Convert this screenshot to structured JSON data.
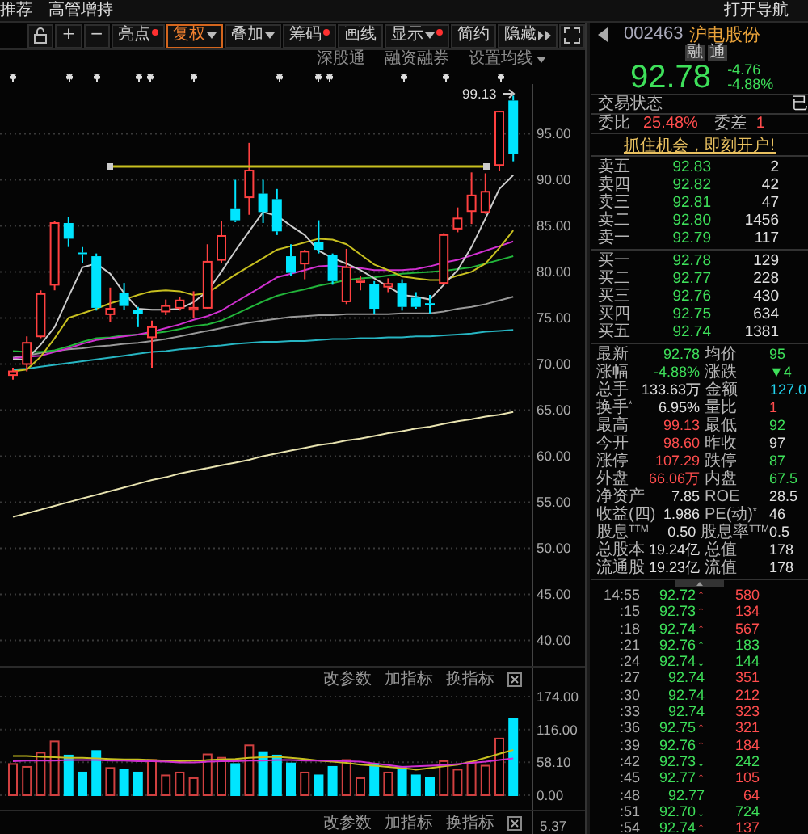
{
  "top_bar": {
    "tabs": [
      "推荐",
      "高管增持"
    ],
    "nav_button": "打开导航"
  },
  "toolbar": [
    {
      "kind": "lock"
    },
    {
      "kind": "text",
      "label": "+",
      "selected": false,
      "dot": false,
      "dropdown": false
    },
    {
      "kind": "text",
      "label": "−",
      "selected": false,
      "dot": false,
      "dropdown": false
    },
    {
      "kind": "text",
      "label": "亮点",
      "selected": false,
      "dot": true,
      "dropdown": false
    },
    {
      "kind": "text",
      "label": "复权",
      "selected": true,
      "dot": false,
      "dropdown": true
    },
    {
      "kind": "text",
      "label": "叠加",
      "selected": false,
      "dot": false,
      "dropdown": true
    },
    {
      "kind": "text",
      "label": "筹码",
      "selected": false,
      "dot": true,
      "dropdown": false
    },
    {
      "kind": "text",
      "label": "画线",
      "selected": false,
      "dot": false,
      "dropdown": false
    },
    {
      "kind": "text",
      "label": "显示",
      "selected": false,
      "dot": true,
      "dropdown": true
    },
    {
      "kind": "text",
      "label": "简约",
      "selected": false,
      "dot": false,
      "dropdown": false
    },
    {
      "kind": "more",
      "label": "隐藏"
    },
    {
      "kind": "fullscreen"
    }
  ],
  "sub_toolbar": {
    "links": [
      "深股通",
      "融资融券"
    ],
    "ma_settings": "设置均线"
  },
  "chart": {
    "high_label": "99.13",
    "chart_data": {
      "type": "candlestick",
      "grid": true,
      "ylim": [
        37.23,
        100.39
      ],
      "yticks": [
        {
          "value": 95,
          "label": "95.00"
        },
        {
          "value": 90,
          "label": "90.00"
        },
        {
          "value": 85,
          "label": "85.00"
        },
        {
          "value": 80,
          "label": "80.00"
        },
        {
          "value": 75,
          "label": "75.00"
        },
        {
          "value": 70,
          "label": "70.00"
        },
        {
          "value": 65,
          "label": "65.00"
        },
        {
          "value": 60,
          "label": "60.00"
        },
        {
          "value": 55,
          "label": "55.00"
        },
        {
          "value": 50,
          "label": "50.00"
        },
        {
          "value": 45,
          "label": "45.00"
        },
        {
          "value": 40,
          "label": "40.00"
        }
      ],
      "series": [
        {
          "type": "line",
          "color": "#e8e3b0",
          "values": [
            53.4,
            53.8,
            54.2,
            54.6,
            55.0,
            55.4,
            55.8,
            56.2,
            56.6,
            57.0,
            57.4,
            57.7,
            58.1,
            58.4,
            58.7,
            59.0,
            59.3,
            59.6,
            60.0,
            60.3,
            60.6,
            60.9,
            61.2,
            61.4,
            61.7,
            61.9,
            62.2,
            62.5,
            62.7,
            63.0,
            63.2,
            63.5,
            63.8,
            64.0,
            64.3,
            64.5,
            64.8
          ]
        },
        {
          "type": "line",
          "color": "#27b5c2",
          "values": [
            69.4,
            69.5,
            69.7,
            69.9,
            70.1,
            70.3,
            70.5,
            70.7,
            70.9,
            71.1,
            71.3,
            71.4,
            71.6,
            71.7,
            71.9,
            72.0,
            72.2,
            72.3,
            72.4,
            72.4,
            72.5,
            72.5,
            72.6,
            72.7,
            72.7,
            72.8,
            72.8,
            72.9,
            72.9,
            73.0,
            73.0,
            73.1,
            73.2,
            73.3,
            73.5,
            73.6,
            73.7
          ]
        },
        {
          "type": "line",
          "color": "#999999",
          "values": [
            70.7,
            70.9,
            71.2,
            71.4,
            71.6,
            71.7,
            71.9,
            72.0,
            72.2,
            72.3,
            72.5,
            72.7,
            73.0,
            73.3,
            73.6,
            73.9,
            74.2,
            74.5,
            74.7,
            74.9,
            75.1,
            75.2,
            75.3,
            75.3,
            75.4,
            75.4,
            75.4,
            75.4,
            75.5,
            75.5,
            75.5,
            75.7,
            76.0,
            76.2,
            76.5,
            76.9,
            77.3
          ]
        },
        {
          "type": "line",
          "color": "#22b53a",
          "values": [
            71.4,
            71.3,
            71.3,
            71.5,
            71.9,
            72.4,
            72.8,
            72.9,
            73.1,
            73.2,
            73.3,
            73.5,
            73.8,
            74.1,
            74.3,
            74.7,
            75.4,
            76.1,
            76.8,
            77.4,
            77.8,
            78.1,
            78.5,
            78.8,
            79.1,
            79.3,
            79.4,
            79.6,
            79.8,
            79.9,
            80.0,
            80.1,
            80.3,
            80.5,
            80.9,
            81.3,
            81.7
          ]
        },
        {
          "type": "line",
          "color": "#d030d0",
          "values": [
            70.6,
            70.8,
            70.9,
            71.3,
            71.7,
            72.2,
            72.6,
            72.8,
            73.0,
            73.2,
            73.5,
            73.9,
            74.3,
            74.8,
            75.2,
            75.8,
            76.7,
            77.6,
            78.5,
            79.4,
            79.8,
            80.2,
            80.6,
            80.7,
            80.5,
            80.4,
            80.2,
            80.2,
            80.2,
            80.3,
            80.6,
            81.0,
            81.3,
            81.8,
            82.3,
            82.8,
            83.3
          ]
        },
        {
          "type": "line",
          "color": "#c8c020",
          "values": [
            69.2,
            69.4,
            70.8,
            72.8,
            75.0,
            75.5,
            76.0,
            76.6,
            77.0,
            77.5,
            77.9,
            78.0,
            77.9,
            77.5,
            77.7,
            78.7,
            79.7,
            80.6,
            81.5,
            82.4,
            82.8,
            83.2,
            83.6,
            83.5,
            83.0,
            81.9,
            80.8,
            80.2,
            79.5,
            79.3,
            79.1,
            79.1,
            79.6,
            80.0,
            80.9,
            82.6,
            84.5
          ]
        },
        {
          "type": "line",
          "color": "#cccccc",
          "values": [
            70.5,
            70.5,
            72.1,
            74.0,
            77.3,
            80.5,
            80.9,
            79.8,
            77.7,
            76.0,
            75.9,
            75.9,
            76.0,
            76.7,
            77.9,
            80.0,
            82.3,
            84.4,
            86.5,
            86.1,
            85.0,
            84.0,
            82.3,
            81.5,
            80.9,
            80.2,
            79.3,
            78.4,
            77.5,
            77.3,
            77.0,
            78.6,
            80.2,
            82.7,
            85.8,
            89.0,
            90.5
          ]
        }
      ],
      "ohlc": [
        [
          68.8,
          69.6,
          68.3,
          69.2
        ],
        [
          70,
          73,
          69.2,
          72.3
        ],
        [
          73,
          78,
          72.8,
          77.6
        ],
        [
          78.6,
          85.5,
          78,
          85.3
        ],
        [
          85.3,
          86,
          82.7,
          83.6
        ],
        [
          82.1,
          82.7,
          81,
          82
        ],
        [
          81.7,
          82,
          75.8,
          76.1
        ],
        [
          75.4,
          78.3,
          74.6,
          76
        ],
        [
          77.7,
          78.8,
          75.9,
          76.3
        ],
        [
          75.9,
          76.2,
          74,
          75.4
        ],
        [
          72.9,
          74.7,
          69.6,
          74
        ],
        [
          75.7,
          77,
          75.3,
          76.3
        ],
        [
          76.1,
          77.3,
          75.8,
          76.9
        ],
        [
          75.9,
          77.9,
          75,
          76.1
        ],
        [
          76.1,
          83,
          76,
          81.1
        ],
        [
          81.3,
          85.5,
          81,
          83.9
        ],
        [
          86.9,
          90,
          85.4,
          85.6
        ],
        [
          88.1,
          94,
          86.2,
          91
        ],
        [
          88.5,
          90,
          85.3,
          86.5
        ],
        [
          87.9,
          89,
          84,
          84.4
        ],
        [
          81.7,
          83,
          79.6,
          79.9
        ],
        [
          80.9,
          82.4,
          79.2,
          82.2
        ],
        [
          83.2,
          85.6,
          82,
          82.4
        ],
        [
          81.8,
          82,
          78.6,
          79
        ],
        [
          76.8,
          82.5,
          76.5,
          80.5
        ],
        [
          78.9,
          79.6,
          78,
          79.1
        ],
        [
          78.7,
          79,
          75.4,
          76
        ],
        [
          78.4,
          79.3,
          77.8,
          78.7
        ],
        [
          78.8,
          79.2,
          75.8,
          76.2
        ],
        [
          77.2,
          77.8,
          76,
          76.2
        ],
        [
          76.6,
          77.5,
          75.4,
          76.4
        ],
        [
          78.8,
          84.2,
          78.6,
          84
        ],
        [
          84.7,
          87,
          84.3,
          85.8
        ],
        [
          86.6,
          90.8,
          85.2,
          88.3
        ],
        [
          86.5,
          90.7,
          86.3,
          88.7
        ],
        [
          91.6,
          97.5,
          91,
          97.4
        ],
        [
          98.6,
          99.13,
          92,
          92.8
        ]
      ]
    }
  },
  "volume_panel": {
    "actions": [
      "改参数",
      "加指标",
      "换指标"
    ],
    "chart_data": {
      "type": "bar",
      "grid": true,
      "ylim": [
        0,
        185.4
      ],
      "yticks": [
        {
          "value": 174,
          "label": "174.00"
        },
        {
          "value": 116,
          "label": "116.00"
        },
        {
          "value": 58.1,
          "label": "58.10"
        },
        {
          "value": 0,
          "label": "0.00"
        }
      ],
      "series": [
        {
          "color": "#d04040",
          "values": [
            55,
            50,
            75,
            95,
            null,
            null,
            null,
            48,
            null,
            null,
            62,
            35,
            40,
            30,
            72,
            66,
            null,
            88,
            null,
            null,
            null,
            40,
            null,
            null,
            62,
            30,
            null,
            40,
            null,
            null,
            null,
            60,
            45,
            58,
            52,
            100,
            null
          ]
        },
        {
          "color": "#00e5ff",
          "values": [
            null,
            null,
            null,
            null,
            70,
            40,
            78,
            null,
            45,
            40,
            null,
            null,
            null,
            null,
            null,
            null,
            55,
            null,
            76,
            70,
            56,
            null,
            35,
            50,
            null,
            null,
            55,
            null,
            50,
            35,
            30,
            null,
            null,
            null,
            null,
            null,
            135
          ]
        },
        {
          "type": "line",
          "color": "#c8c020",
          "values": [
            69,
            69,
            68,
            67,
            66,
            66,
            65,
            64,
            63,
            63,
            62,
            61,
            60,
            61,
            62,
            63,
            64,
            66,
            67,
            68,
            66,
            64,
            61,
            59,
            57,
            54,
            52,
            50,
            48,
            45,
            48,
            51,
            54,
            59,
            66,
            73,
            80
          ]
        },
        {
          "type": "line",
          "color": "#d030d0",
          "values": [
            60,
            61,
            61,
            61,
            62,
            62,
            62,
            61,
            61,
            60,
            60,
            59,
            58,
            58,
            59,
            60,
            60,
            61,
            61,
            62,
            62,
            61,
            61,
            61,
            60,
            59,
            56,
            53,
            50,
            51,
            52,
            53,
            55,
            57,
            59,
            62,
            65
          ]
        }
      ]
    }
  },
  "bottom_panel": {
    "actions": [
      "改参数",
      "加指标",
      "换指标"
    ],
    "y_axis": [
      "5.37"
    ]
  },
  "quote": {
    "code": "002463",
    "name": "沪电股份",
    "badges": [
      "融",
      "通"
    ],
    "price": "92.78",
    "change": "-4.76",
    "change_pct": "-4.88%",
    "status": {
      "label": "交易状态",
      "value": "已"
    },
    "ratio": [
      {
        "label": "委比",
        "value": "25.48%"
      },
      {
        "label": "委差",
        "value": "1"
      }
    ],
    "promo": "抓住机会，即刻开户!"
  },
  "order_book": {
    "asks": [
      {
        "label": "卖五",
        "price": "92.83",
        "volume": "2"
      },
      {
        "label": "卖四",
        "price": "92.82",
        "volume": "42"
      },
      {
        "label": "卖三",
        "price": "92.81",
        "volume": "47"
      },
      {
        "label": "卖二",
        "price": "92.80",
        "volume": "1456"
      },
      {
        "label": "卖一",
        "price": "92.79",
        "volume": "117"
      }
    ],
    "bids": [
      {
        "label": "买一",
        "price": "92.78",
        "volume": "129"
      },
      {
        "label": "买二",
        "price": "92.77",
        "volume": "228"
      },
      {
        "label": "买三",
        "price": "92.76",
        "volume": "430"
      },
      {
        "label": "买四",
        "price": "92.75",
        "volume": "634"
      },
      {
        "label": "买五",
        "price": "92.74",
        "volume": "1381"
      }
    ]
  },
  "stats": [
    {
      "cells": [
        {
          "label": "最新",
          "value": "92.78",
          "color": "#3ee05a"
        },
        {
          "label": "均价",
          "value": "95",
          "color": "#3ee05a"
        }
      ]
    },
    {
      "cells": [
        {
          "label": "涨幅",
          "value": "-4.88%",
          "color": "#3ee05a"
        },
        {
          "label": "涨跌",
          "value": "▼4",
          "color": "#3ee05a"
        }
      ]
    },
    {
      "cells": [
        {
          "label": "总手",
          "value": "133.63万",
          "color": "#e0e0e0"
        },
        {
          "label": "金额",
          "value": "127.0",
          "color": "#22d3ee"
        }
      ]
    },
    {
      "cells": [
        {
          "label": "换手$^{*}$",
          "value": "6.95%",
          "color": "#e0e0e0"
        },
        {
          "label": "量比",
          "value": "1",
          "color": "#ff4d4d"
        }
      ]
    },
    {
      "cells": [
        {
          "label": "最高",
          "value": "99.13",
          "color": "#ff4d4d"
        },
        {
          "label": "最低",
          "value": "92",
          "color": "#3ee05a"
        }
      ]
    },
    {
      "cells": [
        {
          "label": "今开",
          "value": "98.60",
          "color": "#ff4d4d"
        },
        {
          "label": "昨收",
          "value": "97",
          "color": "#e0e0e0"
        }
      ]
    },
    {
      "cells": [
        {
          "label": "涨停",
          "value": "107.29",
          "color": "#ff4d4d"
        },
        {
          "label": "跌停",
          "value": "87",
          "color": "#3ee05a"
        }
      ]
    },
    {
      "cells": [
        {
          "label": "外盘",
          "value": "66.06万",
          "color": "#ff4d4d"
        },
        {
          "label": "内盘",
          "value": "67.5",
          "color": "#3ee05a"
        }
      ]
    },
    {
      "cells": [
        {
          "label": "净资产",
          "value": "7.85",
          "color": "#e0e0e0"
        },
        {
          "label": "ROE",
          "value": "28.5",
          "color": "#e0e0e0"
        }
      ]
    },
    {
      "cells": [
        {
          "label": "收益(四)",
          "value": "1.986",
          "color": "#e0e0e0"
        },
        {
          "label": "PE(动)$^{*}$",
          "value": "46",
          "color": "#e0e0e0"
        }
      ]
    },
    {
      "cells": [
        {
          "label": "股息$^{TTM}$",
          "value": "0.50",
          "color": "#e0e0e0"
        },
        {
          "label": "股息率$^{TTM}$",
          "value": "0.5",
          "color": "#e0e0e0"
        }
      ]
    },
    {
      "cells": [
        {
          "label": "总股本",
          "value": "19.24亿",
          "color": "#e0e0e0"
        },
        {
          "label": "总值",
          "value": "178",
          "color": "#e0e0e0"
        }
      ]
    },
    {
      "cells": [
        {
          "label": "流通股",
          "value": "19.23亿",
          "color": "#e0e0e0"
        },
        {
          "label": "流值",
          "value": "178",
          "color": "#e0e0e0"
        }
      ]
    }
  ],
  "ticks": [
    {
      "time": "14:55",
      "price": "92.72",
      "arrow": "↑",
      "volume": "580",
      "color": "#ff4d4d"
    },
    {
      "time": ":15",
      "price": "92.73",
      "arrow": "↑",
      "volume": "134",
      "color": "#ff4d4d"
    },
    {
      "time": ":18",
      "price": "92.74",
      "arrow": "↑",
      "volume": "567",
      "color": "#ff4d4d"
    },
    {
      "time": ":21",
      "price": "92.76",
      "arrow": "↑",
      "volume": "183",
      "color": "#3ee05a"
    },
    {
      "time": ":24",
      "price": "92.74",
      "arrow": "↓",
      "volume": "144",
      "color": "#3ee05a"
    },
    {
      "time": ":27",
      "price": "92.74",
      "volume": "351",
      "color": "#ff4d4d"
    },
    {
      "time": ":30",
      "price": "92.74",
      "volume": "212",
      "color": "#ff4d4d"
    },
    {
      "time": ":33",
      "price": "92.74",
      "volume": "323",
      "color": "#ff4d4d"
    },
    {
      "time": ":36",
      "price": "92.75",
      "arrow": "↑",
      "volume": "321",
      "color": "#ff4d4d"
    },
    {
      "time": ":39",
      "price": "92.76",
      "arrow": "↑",
      "volume": "184",
      "color": "#ff4d4d"
    },
    {
      "time": ":42",
      "price": "92.73",
      "arrow": "↓",
      "volume": "242",
      "color": "#3ee05a"
    },
    {
      "time": ":45",
      "price": "92.77",
      "arrow": "↑",
      "volume": "105",
      "color": "#ff4d4d"
    },
    {
      "time": ":48",
      "price": "92.77",
      "volume": "64",
      "color": "#ff4d4d"
    },
    {
      "time": ":51",
      "price": "92.70",
      "arrow": "↓",
      "volume": "724",
      "color": "#3ee05a"
    },
    {
      "time": ":54",
      "price": "92.74",
      "arrow": "↑",
      "volume": "137",
      "color": "#ff4d4d"
    }
  ]
}
